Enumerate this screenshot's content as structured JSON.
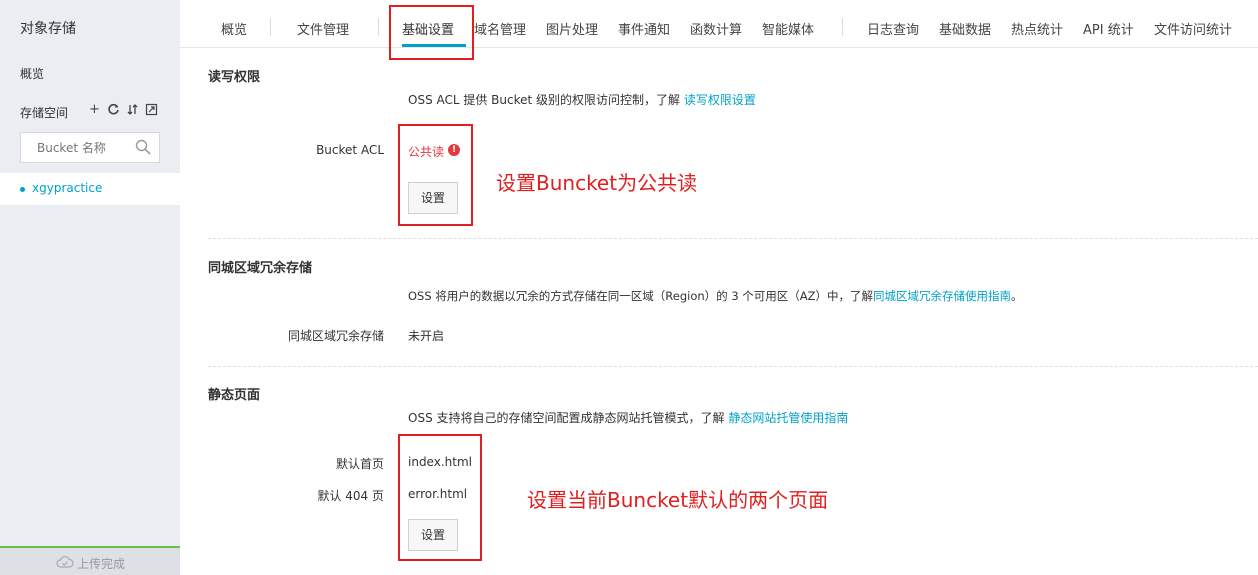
{
  "sidebar": {
    "title": "对象存储",
    "overview": "概览",
    "storage_label": "存储空间",
    "tool_icons": [
      "plus-icon",
      "refresh-icon",
      "sort-icon",
      "expand-icon"
    ],
    "search_placeholder": "Bucket 名称",
    "bucket_name": "xgypractice",
    "upload_status": "上传完成"
  },
  "tabs": [
    {
      "label": "概览"
    },
    {
      "label": "文件管理"
    },
    {
      "label": "基础设置",
      "active": true
    },
    {
      "label": "域名管理"
    },
    {
      "label": "图片处理"
    },
    {
      "label": "事件通知"
    },
    {
      "label": "函数计算"
    },
    {
      "label": "智能媒体"
    },
    {
      "label": "日志查询"
    },
    {
      "label": "基础数据"
    },
    {
      "label": "热点统计"
    },
    {
      "label": "API 统计"
    },
    {
      "label": "文件访问统计"
    }
  ],
  "acl": {
    "title": "读写权限",
    "desc_prefix": "OSS ACL 提供 Bucket 级别的权限访问控制，了解",
    "desc_link": "读写权限设置",
    "label": "Bucket ACL",
    "value": "公共读",
    "button": "设置"
  },
  "redundancy": {
    "title": "同城区域冗余存储",
    "desc_prefix": "OSS 将用户的数据以冗余的方式存储在同一区域（Region）的 3 个可用区（AZ）中，了解",
    "desc_link": "同城区域冗余存储使用指南",
    "desc_suffix": "。",
    "label": "同城区域冗余存储",
    "value": "未开启"
  },
  "static_page": {
    "title": "静态页面",
    "desc_prefix": "OSS 支持将自己的存储空间配置成静态网站托管模式，了解",
    "desc_link": "静态网站托管使用指南",
    "index_label": "默认首页",
    "index_value": "index.html",
    "error_label": "默认 404 页",
    "error_value": "error.html",
    "button": "设置"
  },
  "annotations": {
    "note_acl": "设置Buncket为公共读",
    "note_pages": "设置当前Buncket默认的两个页面"
  },
  "colors": {
    "accent": "#00a2ca",
    "warning": "#e4393c",
    "annotation": "#e02020",
    "upload_bar": "#6cbf4a"
  }
}
